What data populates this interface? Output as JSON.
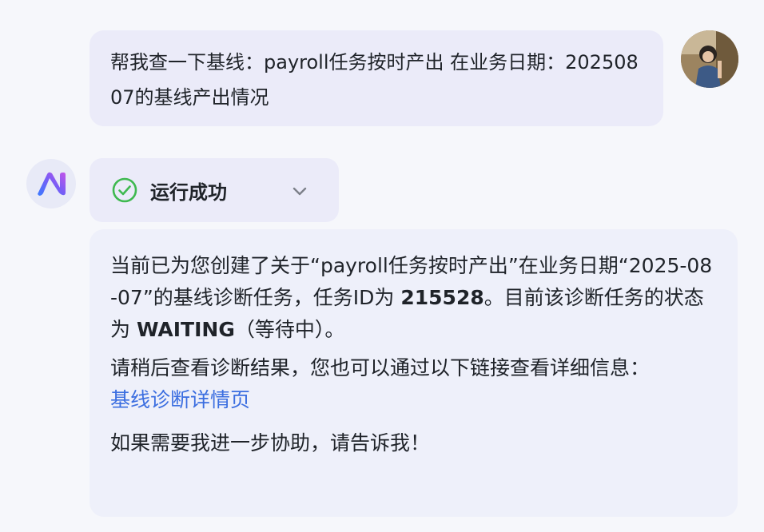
{
  "user": {
    "message": "帮我查一下基线：payroll任务按时产出 在业务日期：20250807的基线产出情况"
  },
  "assistant": {
    "status_label": "运行成功",
    "status_icon": "check-circle-icon",
    "status_color": "#3fb950",
    "answer": {
      "p1_a": "当前已为您创建了关于“payroll任务按时产出”在业务日期“2025-08-07”的基线诊断任务，任务ID为 ",
      "task_id": "215528",
      "p1_b": "。目前该诊断任务的状态为 ",
      "status": "WAITING",
      "p1_c": "（等待中）。",
      "p2": "请稍后查看诊断结果，您也可以通过以下链接查看详细信息：",
      "link_label": "基线诊断详情页",
      "p3": "如果需要我进一步协助，请告诉我！"
    }
  },
  "colors": {
    "link": "#3b6ee0",
    "bubble": "#ebebf9",
    "card": "#eef0fa"
  }
}
